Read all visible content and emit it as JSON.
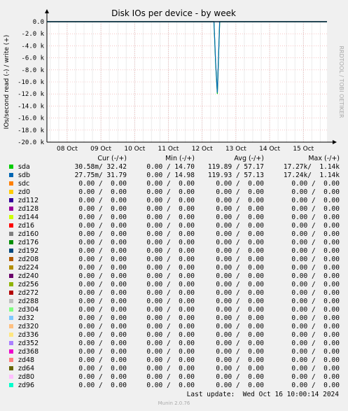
{
  "chart_data": {
    "type": "line",
    "title": "Disk IOs per device - by week",
    "ylabel": "IOs/second read (-) / write (+)",
    "ylim": [
      -20000,
      0
    ],
    "yticks": [
      {
        "value": 0,
        "label": "0.0"
      },
      {
        "value": -2000,
        "label": "-2.0 k"
      },
      {
        "value": -4000,
        "label": "-4.0 k"
      },
      {
        "value": -6000,
        "label": "-6.0 k"
      },
      {
        "value": -8000,
        "label": "-8.0 k"
      },
      {
        "value": -10000,
        "label": "-10.0 k"
      },
      {
        "value": -12000,
        "label": "-12.0 k"
      },
      {
        "value": -14000,
        "label": "-14.0 k"
      },
      {
        "value": -16000,
        "label": "-16.0 k"
      },
      {
        "value": -18000,
        "label": "-18.0 k"
      },
      {
        "value": -20000,
        "label": "-20.0 k"
      }
    ],
    "xlim": [
      0,
      8.3
    ],
    "xticks": [
      {
        "value": 0.6,
        "label": "08 Oct"
      },
      {
        "value": 1.6,
        "label": "09 Oct"
      },
      {
        "value": 2.6,
        "label": "10 Oct"
      },
      {
        "value": 3.6,
        "label": "11 Oct"
      },
      {
        "value": 4.6,
        "label": "12 Oct"
      },
      {
        "value": 5.6,
        "label": "13 Oct"
      },
      {
        "value": 6.6,
        "label": "14 Oct"
      },
      {
        "value": 7.6,
        "label": "15 Oct"
      }
    ],
    "grid": true,
    "series": [
      {
        "name": "sda",
        "color": "#00cc00",
        "x": [
          0,
          4.95,
          5.0,
          5.05,
          5.12,
          8.3
        ],
        "y": [
          0,
          0,
          -7000,
          -12000,
          0,
          0
        ]
      },
      {
        "name": "sdb",
        "color": "#0066b3",
        "x": [
          0,
          4.95,
          5.0,
          5.05,
          5.12,
          8.3
        ],
        "y": [
          0,
          0,
          -6800,
          -11800,
          0,
          0
        ]
      }
    ]
  },
  "legend": {
    "headers": {
      "cur": "Cur (-/+)",
      "min": "Min (-/+)",
      "avg": "Avg (-/+)",
      "max": "Max (-/+)"
    },
    "rows": [
      {
        "name": "sda",
        "color": "#00cc00",
        "cur": "30.58m/ 32.42",
        "min": "0.00 / 14.70",
        "avg": "119.89 / 57.17",
        "max": "17.27k/  1.14k"
      },
      {
        "name": "sdb",
        "color": "#0066b3",
        "cur": "27.75m/ 31.79",
        "min": "0.00 / 14.98",
        "avg": "119.93 / 57.13",
        "max": "17.24k/  1.14k"
      },
      {
        "name": "sdc",
        "color": "#ff8000",
        "cur": "0.00 /  0.00",
        "min": "0.00 /  0.00",
        "avg": "0.00 /  0.00",
        "max": "0.00 /  0.00"
      },
      {
        "name": "zd0",
        "color": "#ffcc00",
        "cur": "0.00 /  0.00",
        "min": "0.00 /  0.00",
        "avg": "0.00 /  0.00",
        "max": "0.00 /  0.00"
      },
      {
        "name": "zd112",
        "color": "#330099",
        "cur": "0.00 /  0.00",
        "min": "0.00 /  0.00",
        "avg": "0.00 /  0.00",
        "max": "0.00 /  0.00"
      },
      {
        "name": "zd128",
        "color": "#990099",
        "cur": "0.00 /  0.00",
        "min": "0.00 /  0.00",
        "avg": "0.00 /  0.00",
        "max": "0.00 /  0.00"
      },
      {
        "name": "zd144",
        "color": "#ccff00",
        "cur": "0.00 /  0.00",
        "min": "0.00 /  0.00",
        "avg": "0.00 /  0.00",
        "max": "0.00 /  0.00"
      },
      {
        "name": "zd16",
        "color": "#ff0000",
        "cur": "0.00 /  0.00",
        "min": "0.00 /  0.00",
        "avg": "0.00 /  0.00",
        "max": "0.00 /  0.00"
      },
      {
        "name": "zd160",
        "color": "#808080",
        "cur": "0.00 /  0.00",
        "min": "0.00 /  0.00",
        "avg": "0.00 /  0.00",
        "max": "0.00 /  0.00"
      },
      {
        "name": "zd176",
        "color": "#008f00",
        "cur": "0.00 /  0.00",
        "min": "0.00 /  0.00",
        "avg": "0.00 /  0.00",
        "max": "0.00 /  0.00"
      },
      {
        "name": "zd192",
        "color": "#00487d",
        "cur": "0.00 /  0.00",
        "min": "0.00 /  0.00",
        "avg": "0.00 /  0.00",
        "max": "0.00 /  0.00"
      },
      {
        "name": "zd208",
        "color": "#b35a00",
        "cur": "0.00 /  0.00",
        "min": "0.00 /  0.00",
        "avg": "0.00 /  0.00",
        "max": "0.00 /  0.00"
      },
      {
        "name": "zd224",
        "color": "#b38f00",
        "cur": "0.00 /  0.00",
        "min": "0.00 /  0.00",
        "avg": "0.00 /  0.00",
        "max": "0.00 /  0.00"
      },
      {
        "name": "zd240",
        "color": "#6b006b",
        "cur": "0.00 /  0.00",
        "min": "0.00 /  0.00",
        "avg": "0.00 /  0.00",
        "max": "0.00 /  0.00"
      },
      {
        "name": "zd256",
        "color": "#8fb300",
        "cur": "0.00 /  0.00",
        "min": "0.00 /  0.00",
        "avg": "0.00 /  0.00",
        "max": "0.00 /  0.00"
      },
      {
        "name": "zd272",
        "color": "#b30000",
        "cur": "0.00 /  0.00",
        "min": "0.00 /  0.00",
        "avg": "0.00 /  0.00",
        "max": "0.00 /  0.00"
      },
      {
        "name": "zd288",
        "color": "#bebebe",
        "cur": "0.00 /  0.00",
        "min": "0.00 /  0.00",
        "avg": "0.00 /  0.00",
        "max": "0.00 /  0.00"
      },
      {
        "name": "zd304",
        "color": "#80ff80",
        "cur": "0.00 /  0.00",
        "min": "0.00 /  0.00",
        "avg": "0.00 /  0.00",
        "max": "0.00 /  0.00"
      },
      {
        "name": "zd32",
        "color": "#80c9ff",
        "cur": "0.00 /  0.00",
        "min": "0.00 /  0.00",
        "avg": "0.00 /  0.00",
        "max": "0.00 /  0.00"
      },
      {
        "name": "zd320",
        "color": "#ffc080",
        "cur": "0.00 /  0.00",
        "min": "0.00 /  0.00",
        "avg": "0.00 /  0.00",
        "max": "0.00 /  0.00"
      },
      {
        "name": "zd336",
        "color": "#ffe680",
        "cur": "0.00 /  0.00",
        "min": "0.00 /  0.00",
        "avg": "0.00 /  0.00",
        "max": "0.00 /  0.00"
      },
      {
        "name": "zd352",
        "color": "#aa80ff",
        "cur": "0.00 /  0.00",
        "min": "0.00 /  0.00",
        "avg": "0.00 /  0.00",
        "max": "0.00 /  0.00"
      },
      {
        "name": "zd368",
        "color": "#ee00cc",
        "cur": "0.00 /  0.00",
        "min": "0.00 /  0.00",
        "avg": "0.00 /  0.00",
        "max": "0.00 /  0.00"
      },
      {
        "name": "zd48",
        "color": "#ff8080",
        "cur": "0.00 /  0.00",
        "min": "0.00 /  0.00",
        "avg": "0.00 /  0.00",
        "max": "0.00 /  0.00"
      },
      {
        "name": "zd64",
        "color": "#666600",
        "cur": "0.00 /  0.00",
        "min": "0.00 /  0.00",
        "avg": "0.00 /  0.00",
        "max": "0.00 /  0.00"
      },
      {
        "name": "zd80",
        "color": "#ffbfff",
        "cur": "0.00 /  0.00",
        "min": "0.00 /  0.00",
        "avg": "0.00 /  0.00",
        "max": "0.00 /  0.00"
      },
      {
        "name": "zd96",
        "color": "#00ffcc",
        "cur": "0.00 /  0.00",
        "min": "0.00 /  0.00",
        "avg": "0.00 /  0.00",
        "max": "0.00 /  0.00"
      }
    ]
  },
  "last_update": "Last update:  Wed Oct 16 10:00:14 2024",
  "footer": "Munin 2.0.76",
  "side_label": "RRDTOOL / TOBI OETIKER"
}
